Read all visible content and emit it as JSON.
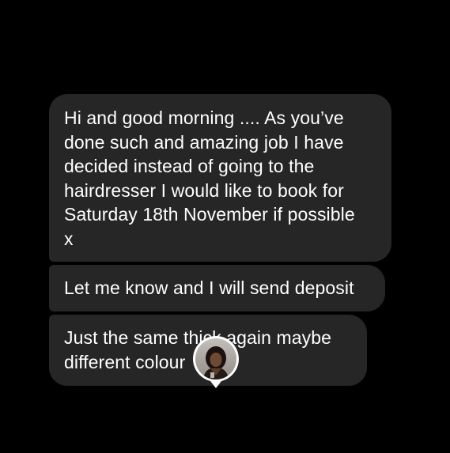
{
  "conversation": {
    "messages": [
      {
        "text": "Hi and good morning .... As you’ve\ndone such and amazing job I have\ndecided instead of going to the\nhairdresser I would like to book for\nSaturday 18th November if possible\nx"
      },
      {
        "text": "Let me know and I will send deposit"
      },
      {
        "text": "Just the same thick again maybe\ndifferent colour"
      }
    ],
    "seen_indicator": {
      "icon": "profile-photo-avatar"
    }
  },
  "colors": {
    "background": "#000000",
    "bubble": "#262626",
    "text": "#ffffff"
  }
}
